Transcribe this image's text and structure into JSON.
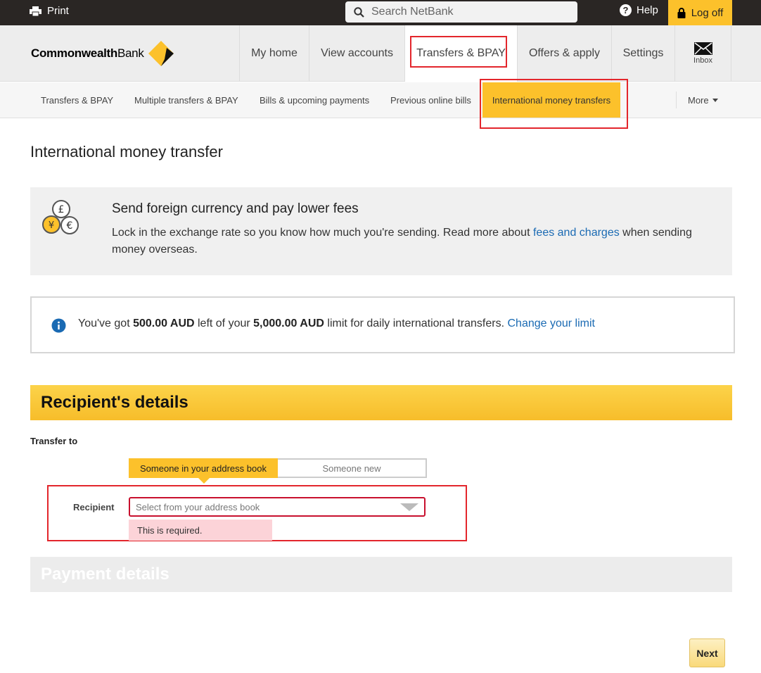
{
  "topbar": {
    "print_label": "Print",
    "search_placeholder": "Search NetBank",
    "help_label": "Help",
    "logoff_label": "Log off"
  },
  "brand": {
    "name_bold": "Commonwealth",
    "name_regular": "Bank",
    "accent": "#fcc12b"
  },
  "main_nav": {
    "items": [
      {
        "label": "My home"
      },
      {
        "label": "View accounts"
      },
      {
        "label": "Transfers & BPAY",
        "active": true
      },
      {
        "label": "Offers & apply"
      },
      {
        "label": "Settings"
      }
    ],
    "inbox_label": "Inbox"
  },
  "sub_nav": {
    "items": [
      {
        "label": "Transfers & BPAY"
      },
      {
        "label": "Multiple transfers & BPAY"
      },
      {
        "label": "Bills & upcoming payments"
      },
      {
        "label": "Previous online bills"
      },
      {
        "label": "International money transfers",
        "active": true
      }
    ],
    "more_label": "More"
  },
  "page": {
    "title": "International money transfer"
  },
  "promo": {
    "icon": "currency-coins-icon",
    "title": "Send foreign currency and pay lower fees",
    "text_before": "Lock in the exchange rate so you know how much you're sending. Read more about ",
    "link": "fees and charges",
    "text_after": " when sending money overseas."
  },
  "limit_info": {
    "icon": "info-icon",
    "prefix": "You've got ",
    "remaining": "500.00 AUD",
    "middle": " left of your ",
    "limit": "5,000.00 AUD",
    "suffix": " limit for daily international transfers. ",
    "link": "Change your limit"
  },
  "recipient_section": {
    "title": "Recipient's details",
    "transfer_to_label": "Transfer to",
    "toggle": {
      "option_1": "Someone in your address book",
      "option_2": "Someone new",
      "selected": "Someone in your address book"
    },
    "recipient_label": "Recipient",
    "select_placeholder": "Select from your address book",
    "error": "This is required."
  },
  "payment_section": {
    "title": "Payment details"
  },
  "actions": {
    "next_label": "Next"
  }
}
